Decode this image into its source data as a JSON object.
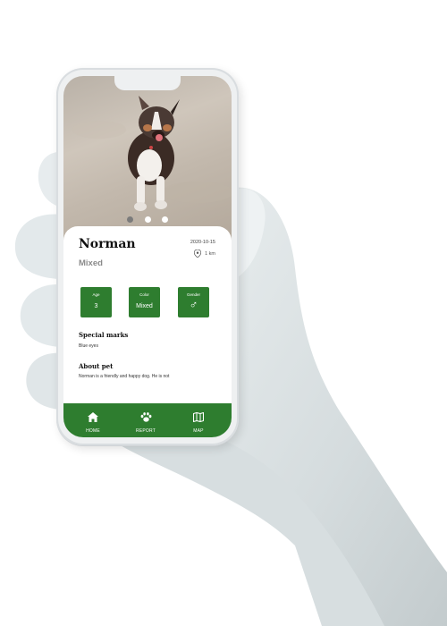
{
  "pet": {
    "name": "Norman",
    "breed": "Mixed",
    "date": "2020-10-15",
    "distance": "1 km"
  },
  "carousel": {
    "count": 3,
    "active": 0
  },
  "stats": [
    {
      "label": "Age",
      "value": "3"
    },
    {
      "label": "Color",
      "value": "Mixed"
    },
    {
      "label": "Gender",
      "value": "♂"
    }
  ],
  "special_marks": {
    "heading": "Special marks",
    "text": "Blue eyes"
  },
  "about": {
    "heading": "About pet",
    "text": "Norman is a friendly and happy dog. He is not"
  },
  "nav": {
    "home": "HOME",
    "report": "REPORT",
    "map": "MAP"
  },
  "colors": {
    "primary_green": "#2e7d2f",
    "nav_text": "#ffffff"
  },
  "icons": {
    "home": "home-icon",
    "report": "paw-icon",
    "map": "map-icon",
    "location": "location-pin-icon"
  }
}
